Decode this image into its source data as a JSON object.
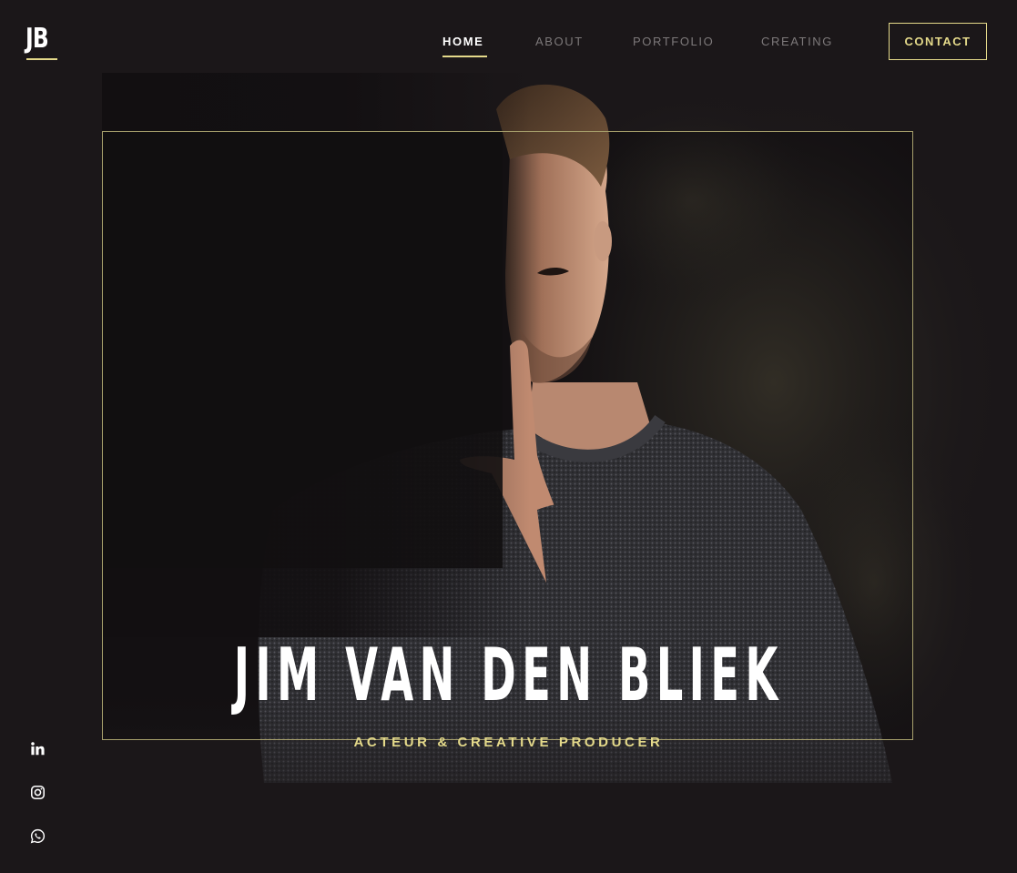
{
  "brand": {
    "logo_text": "JB"
  },
  "nav": {
    "items": [
      {
        "label": "HOME"
      },
      {
        "label": "ABOUT"
      },
      {
        "label": "PORTFOLIO"
      },
      {
        "label": "CREATING"
      }
    ],
    "active_index": 0,
    "cta_label": "CONTACT"
  },
  "hero": {
    "name": "JIM VAN DEN BLIEK",
    "subtitle": "ACTEUR & CREATIVE PRODUCER",
    "photo": "portrait-man-finger-on-lips"
  },
  "social": [
    {
      "icon": "linkedin-icon"
    },
    {
      "icon": "instagram-icon"
    },
    {
      "icon": "whatsapp-icon"
    }
  ],
  "colors": {
    "background": "#1b1719",
    "accent": "#e4d98a",
    "frame": "#a7a06c",
    "nav_inactive": "#7d797a",
    "text_primary": "#ffffff"
  }
}
